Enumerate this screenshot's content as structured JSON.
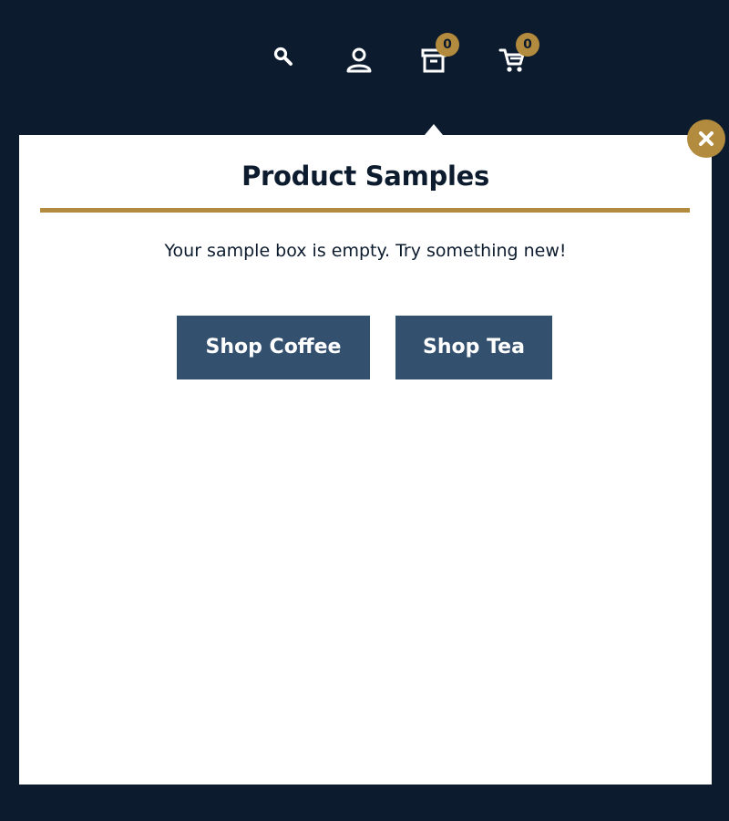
{
  "header": {
    "icons": {
      "search": "search-icon",
      "account": "user-icon",
      "samples": "sample-box-icon",
      "cart": "cart-icon"
    },
    "samples_count": "0",
    "cart_count": "0"
  },
  "popover": {
    "title": "Product Samples",
    "message": "Your sample box is empty. Try something new!",
    "buttons": {
      "coffee": "Shop Coffee",
      "tea": "Shop Tea"
    },
    "close_icon": "close-icon"
  },
  "colors": {
    "background": "#0c1b2d",
    "accent": "#b38b3e",
    "button": "#33506f",
    "panel": "#ffffff"
  }
}
